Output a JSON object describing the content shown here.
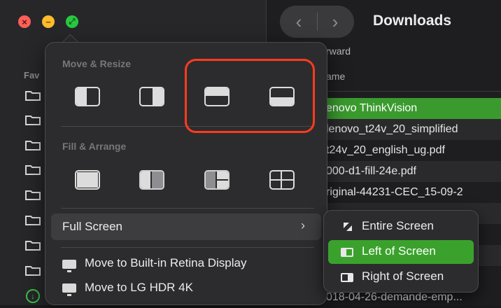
{
  "finder": {
    "title": "Downloads",
    "sidebar_heading": "Fav",
    "columns": {
      "forward": "rward",
      "name": "ame"
    },
    "files": [
      "enovo ThinkVision",
      "lenovo_t24v_20_simplified",
      "t24v_20_english_ug.pdf",
      "000-d1-fill-24e.pdf",
      "riginal-44231-CEC_15-09-2",
      "",
      "",
      "",
      "018-04-26-demande-emp..."
    ]
  },
  "menu": {
    "move_resize_title": "Move & Resize",
    "fill_arrange_title": "Fill & Arrange",
    "full_screen_label": "Full Screen",
    "full_screen_chevron": "›",
    "move_builtin": "Move to Built-in Retina Display",
    "move_lg": "Move to LG HDR 4K"
  },
  "submenu": {
    "items": [
      {
        "label": "Entire Screen",
        "icon": "entire-screen-icon",
        "active": false
      },
      {
        "label": "Left of Screen",
        "icon": "left-of-screen-icon",
        "active": true
      },
      {
        "label": "Right of Screen",
        "icon": "right-of-screen-icon",
        "active": false
      }
    ]
  },
  "colors": {
    "accent_green": "#3aa22c",
    "annotation_red": "#ff3b1f",
    "menu_bg": "#2c2c2e"
  },
  "icons": {
    "close": "close-icon",
    "minimize": "minimize-icon",
    "zoom": "zoom-icon",
    "back": "chevron-left-icon",
    "forward": "chevron-right-icon",
    "folder": "folder-icon",
    "download": "download-icon"
  }
}
